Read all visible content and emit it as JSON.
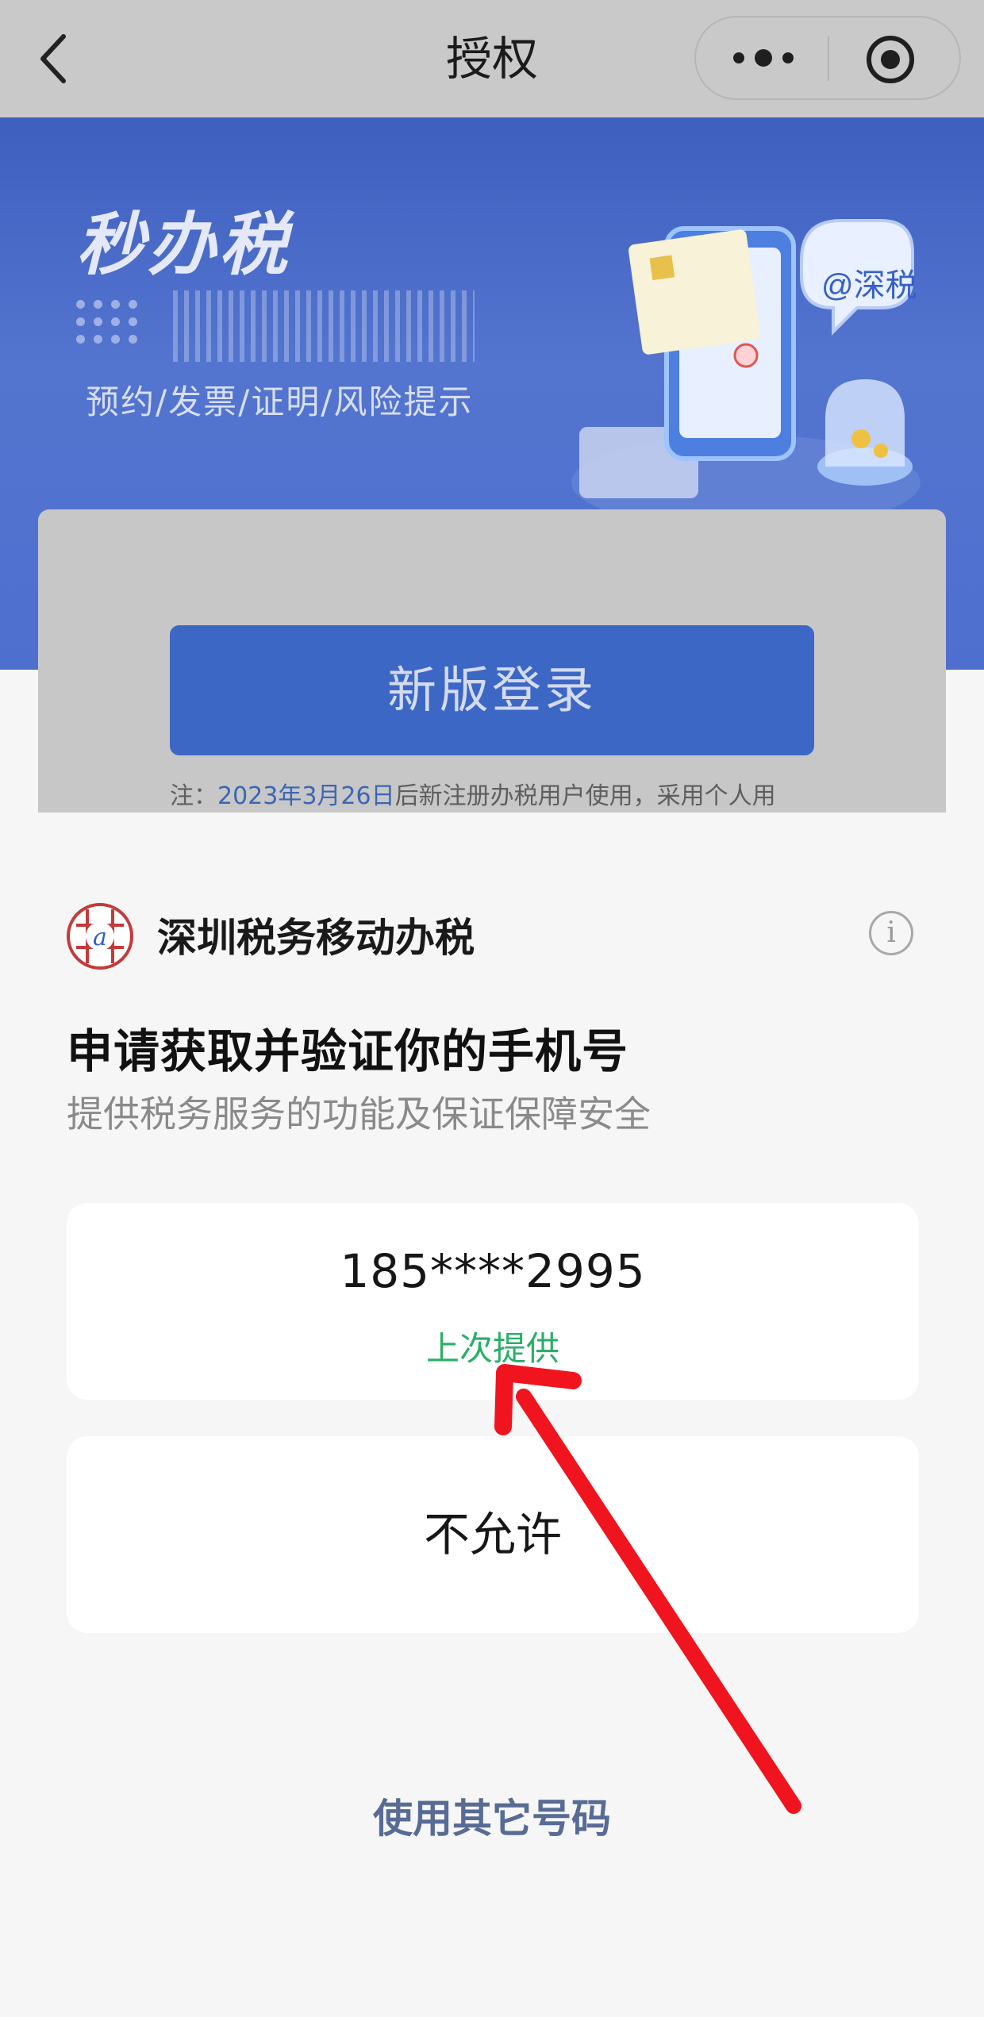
{
  "nav": {
    "title": "授权",
    "more_icon": "more-dots-icon",
    "close_icon": "target-circle-icon",
    "back_icon": "chevron-left-icon"
  },
  "banner": {
    "brand": "秒办税",
    "subtitle": "预约/发票/证明/风险提示",
    "badge": "@深税"
  },
  "login": {
    "button_label": "新版登录",
    "note_prefix": "注：",
    "note_date": "2023年3月26日",
    "note_suffix": "后新注册办税用户使用，采用个人用"
  },
  "sheet": {
    "app_name": "深圳税务移动办税",
    "info_icon": "i",
    "title": "申请获取并验证你的手机号",
    "description": "提供税务服务的功能及保证保障安全",
    "phone_number": "185****2995",
    "phone_tag": "上次提供",
    "deny_label": "不允许",
    "other_label": "使用其它号码"
  },
  "colors": {
    "accent_blue": "#3d67c5",
    "tag_green": "#2aae67",
    "link_blue": "#576b95",
    "arrow_red": "#f0141e"
  }
}
